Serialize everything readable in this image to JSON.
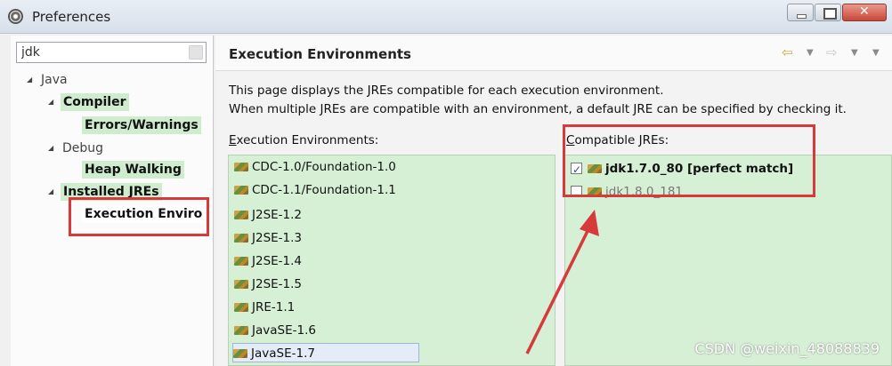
{
  "window": {
    "title": "Preferences"
  },
  "nav": {
    "filter_value": "jdk",
    "tree": {
      "java": "Java",
      "compiler": "Compiler",
      "errors_warnings": "Errors/Warnings",
      "debug": "Debug",
      "heap_walking": "Heap Walking",
      "installed_jres": "Installed JREs",
      "execution_environments": "Execution Enviro"
    }
  },
  "page": {
    "title": "Execution Environments",
    "description": [
      "This page displays the JREs compatible for each execution environment.",
      "When multiple JREs are compatible with an environment, a default JRE can be specified by checking it."
    ],
    "environments_label": {
      "mnemonic": "E",
      "rest": "xecution Environments:"
    },
    "jres_label": {
      "mnemonic": "C",
      "rest": "ompatible JREs:"
    },
    "environments": [
      "CDC-1.0/Foundation-1.0",
      "CDC-1.1/Foundation-1.1",
      "J2SE-1.2",
      "J2SE-1.3",
      "J2SE-1.4",
      "J2SE-1.5",
      "JRE-1.1",
      "JavaSE-1.6",
      "JavaSE-1.7"
    ],
    "selected_environment": "JavaSE-1.7",
    "jres": [
      {
        "name": "jdk1.7.0_80 [perfect match]",
        "checked": true
      },
      {
        "name": "jdk1.8.0_181",
        "checked": false
      }
    ]
  },
  "watermark": "CSDN @weixin_48088839",
  "colors": {
    "annotation": "#d63a3a",
    "highlight": "#cfeccf",
    "list_background": "#d6f0d6"
  },
  "icons": {
    "header_back": "back-arrow-icon",
    "header_forward": "forward-arrow-icon",
    "jre_item": "jdk-library-icon"
  }
}
